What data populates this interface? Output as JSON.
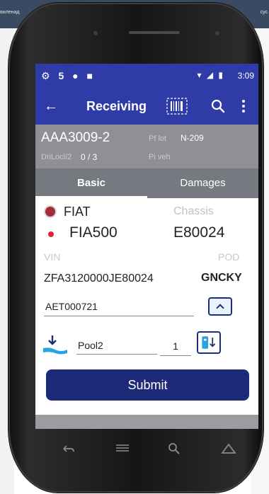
{
  "desktop": {
    "left_text": "виленад",
    "right_text": "сус"
  },
  "status_bar": {
    "left_icons": "⚙ 5 ● ■",
    "right_icons": "▾ ◢ ▮",
    "time": "3:09"
  },
  "app_bar": {
    "title": "Receiving",
    "back_icon": "arrow-left",
    "barcode_icon": "barcode",
    "search_icon": "search",
    "more_icon": "more-vertical"
  },
  "header": {
    "order_no": "AAA3009-2",
    "pf_label": "Pf lot",
    "pf_value": "N-209",
    "loc_label": "DriLocl/2",
    "loc_value": "0 / 3",
    "veh_label": "Pi veh"
  },
  "tabs": [
    {
      "label": "Basic",
      "active": true
    },
    {
      "label": "Damages",
      "active": false
    }
  ],
  "vehicle": {
    "brand": "FIAT",
    "model": "FIA500",
    "chassis_label": "Chassis",
    "chassis_value": "E80024",
    "vin_label": "VIN",
    "vin_value": "ZFA3120000JE80024",
    "pod_label": "POD",
    "pod_value": "GNCKY"
  },
  "inputs": {
    "aet_value": "AET000721",
    "pool_value": "Pool2",
    "qty_value": "1"
  },
  "submit_label": "Submit",
  "colors": {
    "primary": "#2f3ca8",
    "button": "#1d2a78",
    "header_gray": "#8e9096",
    "tab_gray": "#777980",
    "accent_red": "#e4233b"
  }
}
